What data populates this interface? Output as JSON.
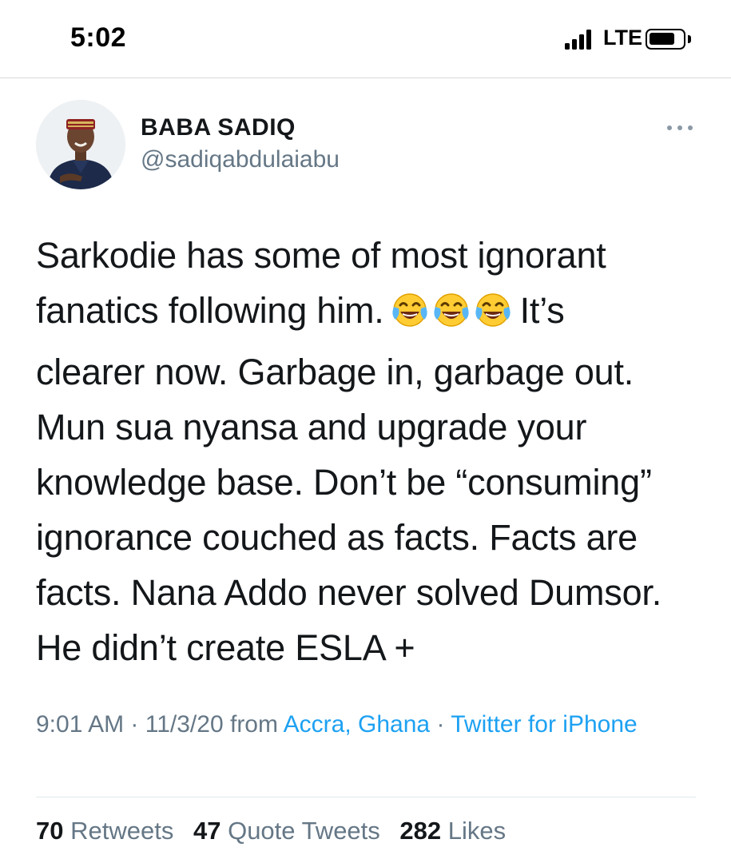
{
  "status_bar": {
    "time": "5:02",
    "network": "LTE",
    "battery_level": 0.8,
    "signal_bars": 4
  },
  "tweet": {
    "author": {
      "display_name": "BABA SADIQ",
      "handle": "@sadiqabdulaiabu"
    },
    "text": {
      "line1": "Sarkodie has some of most ignorant",
      "line2_start": "fanatics following him.",
      "line2_emojis": [
        "face-with-tears-of-joy-emoji",
        "face-with-tears-of-joy-emoji",
        "face-with-tears-of-joy-emoji"
      ],
      "line2_end": "It’s",
      "line3": "clearer now. Garbage in, garbage out.",
      "line4": "Mun sua nyansa and upgrade your",
      "line5": "knowledge base. Don’t be “consuming”",
      "line6": "ignorance couched as facts. Facts are",
      "line7": "facts. Nana Addo never solved Dumsor.",
      "line8": "He didn’t create ESLA +"
    },
    "meta": {
      "time": "9:01 AM",
      "separator": "·",
      "date": "11/3/20",
      "from": "from",
      "location": "Accra, Ghana",
      "client": "Twitter for iPhone"
    },
    "stats": {
      "retweets_count": "70",
      "retweets_label": "Retweets",
      "quotes_count": "47",
      "quotes_label": "Quote Tweets",
      "likes_count": "282",
      "likes_label": "Likes"
    }
  },
  "colors": {
    "text": "#14171a",
    "secondary": "#657786",
    "link": "#1da1f2",
    "divider": "#e1e8ed"
  }
}
